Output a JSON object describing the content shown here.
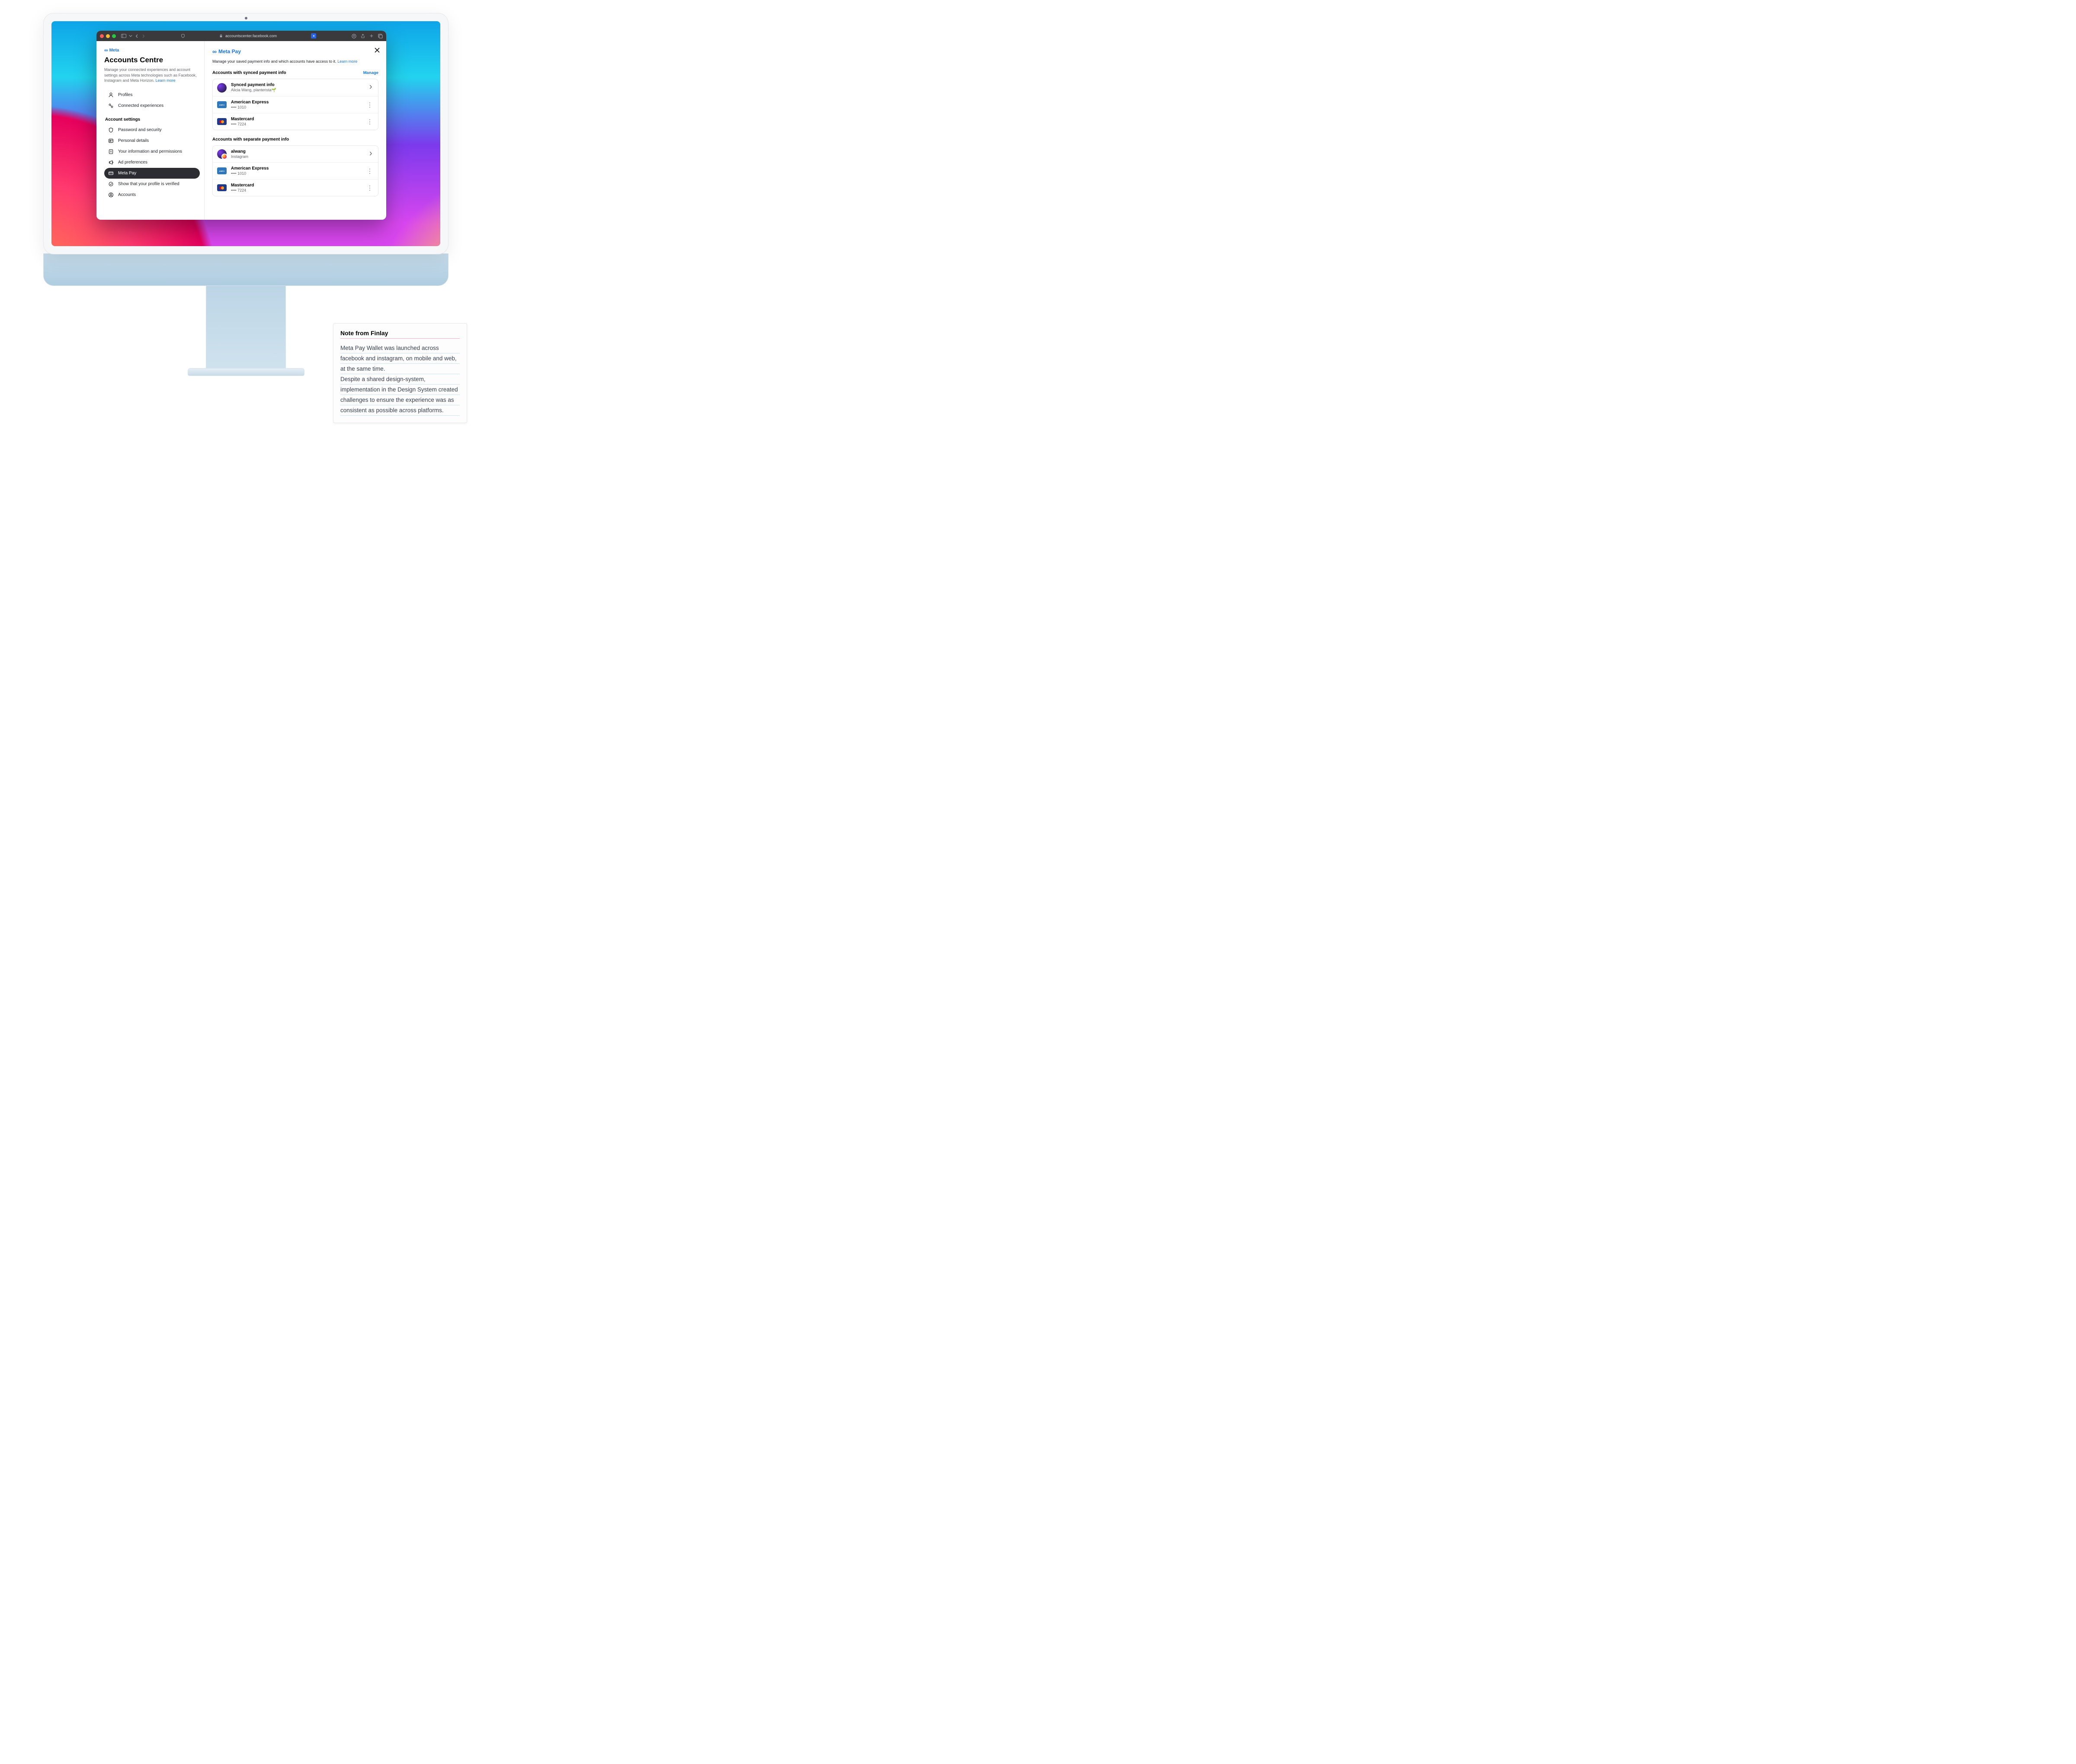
{
  "browser": {
    "url": "accountscenter.facebook.com"
  },
  "sidebar": {
    "brand": "Meta",
    "title": "Accounts Centre",
    "description": "Manage your connected experiences and account settings across Meta technologies such as Facebook, Instagram and Meta Horizon.",
    "learn_more": "Learn more",
    "items_top": [
      {
        "label": "Profiles"
      },
      {
        "label": "Connected experiences"
      }
    ],
    "settings_label": "Account settings",
    "items_settings": [
      {
        "label": "Password and security"
      },
      {
        "label": "Personal details"
      },
      {
        "label": "Your information and permissions"
      },
      {
        "label": "Ad preferences"
      },
      {
        "label": "Meta Pay"
      },
      {
        "label": "Show that your profile is verified"
      },
      {
        "label": "Accounts"
      }
    ]
  },
  "main": {
    "brand": "Meta Pay",
    "description": "Manage your saved payment info and which accounts have access to it.",
    "learn_more": "Learn more",
    "group_synced": {
      "title": "Accounts with synced payment info",
      "manage": "Manage",
      "synced_row": {
        "title": "Synced payment info",
        "subtitle": "Alicia Wang, planterista🌱"
      },
      "cards": [
        {
          "brand": "American Express",
          "last4": "1010",
          "type": "amex"
        },
        {
          "brand": "Mastercard",
          "last4": "7224",
          "type": "mc"
        }
      ]
    },
    "group_separate": {
      "title": "Accounts with separate payment info",
      "account_row": {
        "title": "alwang",
        "subtitle": "Instagram"
      },
      "cards": [
        {
          "brand": "American Express",
          "last4": "1010",
          "type": "amex"
        },
        {
          "brand": "Mastercard",
          "last4": "7224",
          "type": "mc"
        }
      ]
    }
  },
  "note": {
    "title": "Note from Finlay",
    "p1": "Meta Pay Wallet was launched across facebook and instagram, on mobile and web, at the same time.",
    "p2": "Despite a shared design-system, implementation in the Design System created challenges to ensure the experience was as consistent as possible across platforms."
  }
}
